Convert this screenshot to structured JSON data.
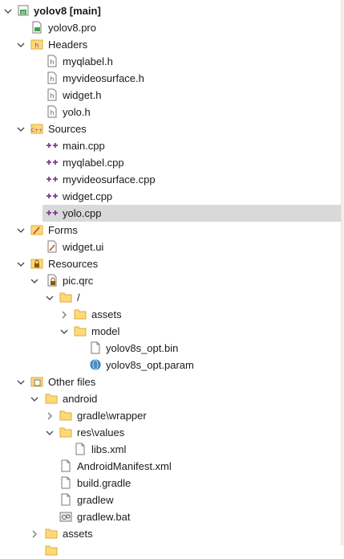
{
  "project": {
    "name": "yolov8 [main]"
  },
  "items": {
    "pro_file": "yolov8.pro",
    "headers": "Headers",
    "h_myqlabel": "myqlabel.h",
    "h_myvideosurface": "myvideosurface.h",
    "h_widget": "widget.h",
    "h_yolo": "yolo.h",
    "sources": "Sources",
    "s_main": "main.cpp",
    "s_myqlabel": "myqlabel.cpp",
    "s_myvideosurface": "myvideosurface.cpp",
    "s_widget": "widget.cpp",
    "s_yolo": "yolo.cpp",
    "forms": "Forms",
    "f_widget": "widget.ui",
    "resources": "Resources",
    "r_picqrc": "pic.qrc",
    "r_root": "/",
    "r_assets": "assets",
    "r_model": "model",
    "r_bin": "yolov8s_opt.bin",
    "r_param": "yolov8s_opt.param",
    "other": "Other files",
    "o_android": "android",
    "o_gradlewrapper": "gradle\\wrapper",
    "o_resvalues": "res\\values",
    "o_libsxml": "libs.xml",
    "o_manifest": "AndroidManifest.xml",
    "o_buildgradle": "build.gradle",
    "o_gradlew": "gradlew",
    "o_gradlewbat": "gradlew.bat",
    "o_assets": "assets"
  },
  "colors": {
    "selection": "#d9d9d9",
    "folder": "#ffd978",
    "header_icon": "#7a3f8f",
    "source_icon": "#7a3f8f"
  }
}
